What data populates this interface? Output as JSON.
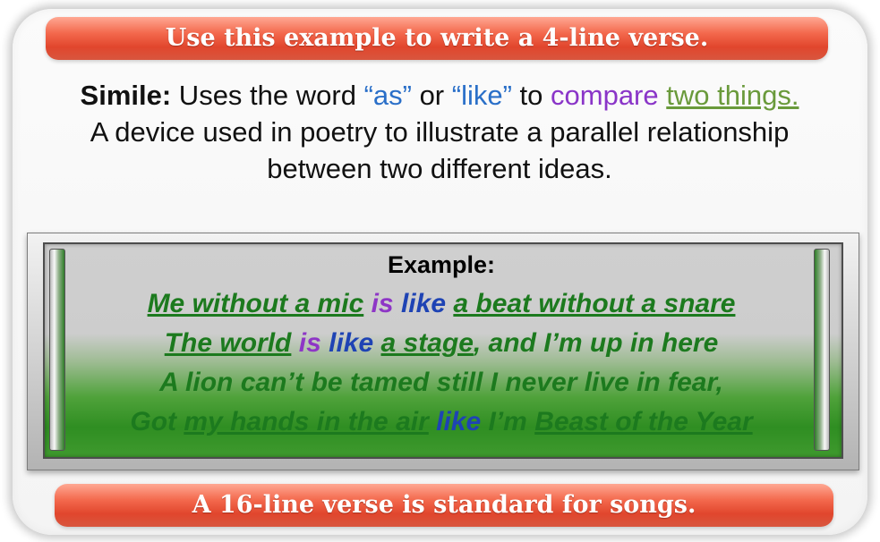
{
  "header_banner": "Use this example to write a 4-line verse.",
  "definition": {
    "term": "Simile:",
    "t1": " Uses the word ",
    "as": "“as”",
    "t2": " or ",
    "like": "“like”",
    "t3": " to ",
    "compare": "compare",
    "t4": " ",
    "two_things": "two things.",
    "line2": "A device used in poetry to illustrate a parallel relationship",
    "line3": "between two different ideas."
  },
  "example": {
    "title": "Example:",
    "lines": [
      [
        {
          "text": "Me without a mic",
          "style": "underline"
        },
        {
          "text": " ",
          "style": "plain"
        },
        {
          "text": "is",
          "style": "purple"
        },
        {
          "text": " ",
          "style": "plain"
        },
        {
          "text": "like",
          "style": "blue"
        },
        {
          "text": " ",
          "style": "plain"
        },
        {
          "text": "a beat without a snare",
          "style": "underline"
        }
      ],
      [
        {
          "text": "The world",
          "style": "underline"
        },
        {
          "text": " ",
          "style": "plain"
        },
        {
          "text": "is",
          "style": "purple"
        },
        {
          "text": " ",
          "style": "plain"
        },
        {
          "text": "like",
          "style": "blue"
        },
        {
          "text": " ",
          "style": "plain"
        },
        {
          "text": "a stage",
          "style": "underline"
        },
        {
          "text": ", and I’m up in here",
          "style": "plain"
        }
      ],
      [
        {
          "text": "A lion can’t be tamed still I never live in fear,",
          "style": "plain"
        }
      ],
      [
        {
          "text": "Got ",
          "style": "plain"
        },
        {
          "text": "my hands in the air",
          "style": "underline"
        },
        {
          "text": " ",
          "style": "plain"
        },
        {
          "text": "like",
          "style": "blue"
        },
        {
          "text": " I’m ",
          "style": "plain"
        },
        {
          "text": "Beast of the Year",
          "style": "underline"
        }
      ]
    ]
  },
  "footer_banner": "A 16-line verse is standard for songs."
}
